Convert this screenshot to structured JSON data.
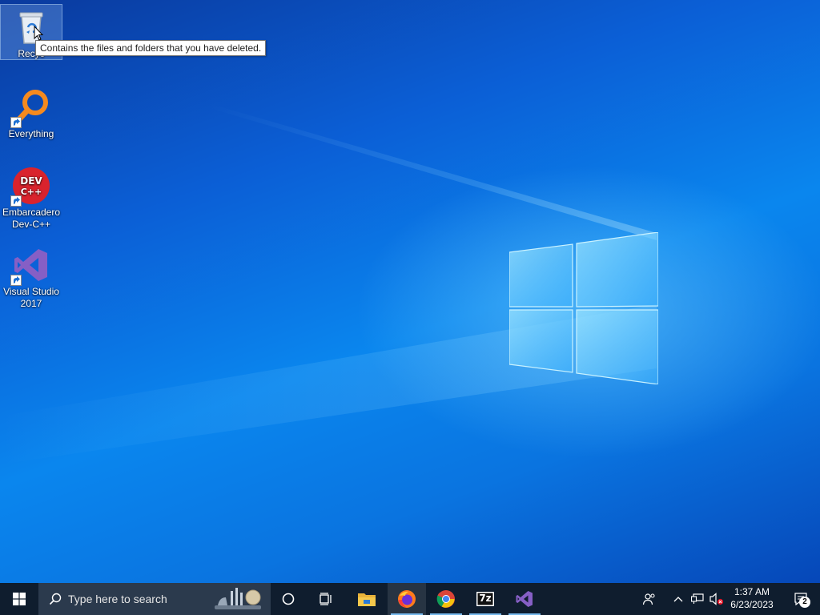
{
  "desktop": {
    "icons": [
      {
        "label": "Recycle Bin",
        "label_visible": "Recyc"
      },
      {
        "label": "Everything"
      },
      {
        "label": "Embarcadero Dev-C++",
        "label_line1": "Embarcadero",
        "label_line2": "Dev-C++",
        "icon_text": "DEV C++"
      },
      {
        "label": "Visual Studio 2017",
        "label_line1": "Visual Studio",
        "label_line2": "2017"
      }
    ],
    "tooltip": "Contains the files and folders that you have deleted."
  },
  "taskbar": {
    "search_placeholder": "Type here to search",
    "pinned": [
      {
        "name": "file-explorer"
      },
      {
        "name": "firefox",
        "active": true
      },
      {
        "name": "chrome",
        "running": true
      },
      {
        "name": "7zip",
        "icon_text": "7z",
        "running": true
      },
      {
        "name": "visual-studio",
        "running": true
      }
    ],
    "clock": {
      "time": "1:37 AM",
      "date": "6/23/2023"
    },
    "notification_count": "2"
  },
  "colors": {
    "taskbar": "#0f1d2e",
    "search_box": "#2b3a4d",
    "accent": "#76b9ed"
  }
}
